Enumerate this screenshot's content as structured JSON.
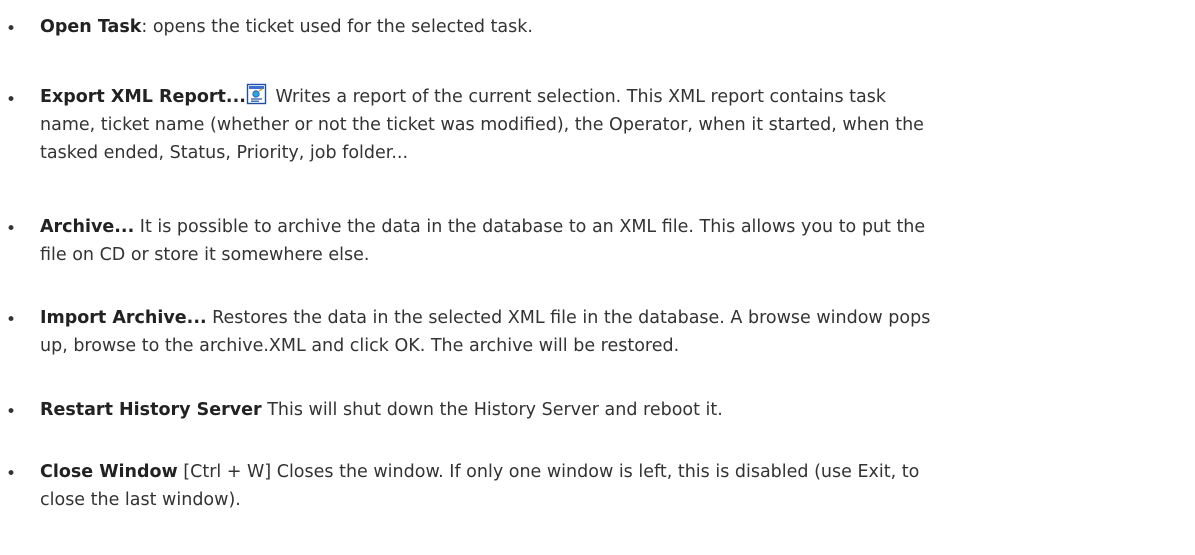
{
  "items": [
    {
      "term": "Open Task",
      "desc": ": opens the ticket used for the selected task."
    },
    {
      "term": "Export XML Report...",
      "icon": "xml-report-icon",
      "desc_line_1": " Writes a report of the current selection. This XML report contains task",
      "desc_line_2": "name, ticket name (whether or not the ticket was modified), the Operator, when it started, when the",
      "desc_line_3": "tasked ended, Status, Priority, job folder..."
    },
    {
      "term": "Archive...",
      "desc_line_1": " It is possible to archive the data in the database to an XML file. This allows you to put the",
      "desc_line_2": "file on CD or store it somewhere else."
    },
    {
      "term": "Import Archive...",
      "desc_line_1": " Restores the data in the selected XML file in the database. A browse window pops",
      "desc_line_2": "up, browse to the archive.XML and click OK. The archive will be restored."
    },
    {
      "term": "Restart History Server",
      "desc": " This will shut down the History Server and reboot it."
    },
    {
      "term": "Close Window",
      "desc_line_1": " [Ctrl + W] Closes the window. If only one window is left, this is disabled (use Exit, to",
      "desc_line_2": "close the last window)."
    }
  ],
  "bullet": "•",
  "colors": {
    "text": "#333333",
    "term": "#222222",
    "background": "#ffffff"
  }
}
